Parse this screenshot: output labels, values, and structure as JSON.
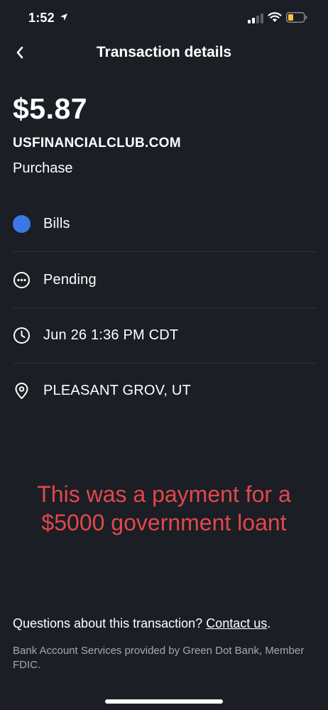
{
  "status_bar": {
    "time": "1:52",
    "location_icon": "location-arrow-icon",
    "signal_icon": "cellular-signal-icon",
    "wifi_icon": "wifi-icon",
    "battery_icon": "battery-low-icon",
    "battery_color": "#f5c742"
  },
  "header": {
    "back_icon": "chevron-left-icon",
    "title": "Transaction details"
  },
  "transaction": {
    "amount": "$5.87",
    "merchant": "USFINANCIALCLUB.COM",
    "type": "Purchase"
  },
  "details": [
    {
      "icon": "category-dot-icon",
      "icon_color": "#3b78e7",
      "label": "Bills"
    },
    {
      "icon": "pending-ellipsis-icon",
      "label": "Pending"
    },
    {
      "icon": "clock-icon",
      "label": "Jun 26 1:36 PM CDT"
    },
    {
      "icon": "map-pin-icon",
      "label": "PLEASANT GROV, UT"
    }
  ],
  "annotation": {
    "line1": "This was a payment for a",
    "line2": "$5000 government loant",
    "color": "#e0484c"
  },
  "footer": {
    "question": "Questions about this transaction?",
    "contact_link": "Contact us",
    "period": ".",
    "disclosure": "Bank Account Services provided by Green Dot Bank, Member FDIC."
  }
}
